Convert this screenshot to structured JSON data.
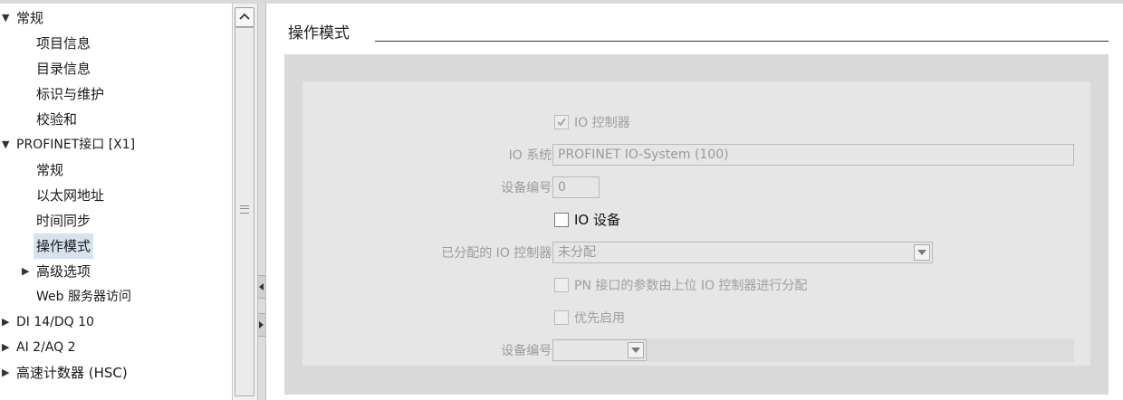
{
  "nav": {
    "items": [
      {
        "label": "常规",
        "arrow": "▼",
        "level": 0
      },
      {
        "label": "项目信息",
        "arrow": "",
        "level": 2
      },
      {
        "label": "目录信息",
        "arrow": "",
        "level": 2
      },
      {
        "label": "标识与维护",
        "arrow": "",
        "level": 2
      },
      {
        "label": "校验和",
        "arrow": "",
        "level": 2
      },
      {
        "label": "PROFINET接口 [X1]",
        "arrow": "▼",
        "level": 0
      },
      {
        "label": "常规",
        "arrow": "",
        "level": 2
      },
      {
        "label": "以太网地址",
        "arrow": "",
        "level": 2
      },
      {
        "label": "时间同步",
        "arrow": "",
        "level": 2
      },
      {
        "label": "操作模式",
        "arrow": "",
        "level": 2,
        "selected": true
      },
      {
        "label": "高级选项",
        "arrow": "▶",
        "level": 1
      },
      {
        "label": "Web 服务器访问",
        "arrow": "",
        "level": 2
      },
      {
        "label": "DI 14/DQ 10",
        "arrow": "▶",
        "level": 0
      },
      {
        "label": "AI 2/AQ 2",
        "arrow": "▶",
        "level": 0
      },
      {
        "label": "高速计数器 (HSC)",
        "arrow": "▶",
        "level": 0
      }
    ]
  },
  "section": {
    "title": "操作模式"
  },
  "form": {
    "io_controller_label": "IO 控制器",
    "io_system_label": "IO 系统:",
    "io_system_value": "PROFINET IO-System (100)",
    "device_number_label": "设备编号:",
    "device_number_value": "0",
    "io_device_label": "IO 设备",
    "assigned_controller_label": "已分配的 IO 控制器:",
    "assigned_controller_value": "未分配",
    "pn_param_label": "PN 接口的参数由上位 IO 控制器进行分配",
    "priority_label": "优先启用",
    "device_number2_label": "设备编号:",
    "device_number2_value": ""
  },
  "colors": {
    "selected_bg": "#d6e2ee",
    "panel_bg": "#d9d9d9",
    "disabled_text": "#9c9c9c"
  }
}
